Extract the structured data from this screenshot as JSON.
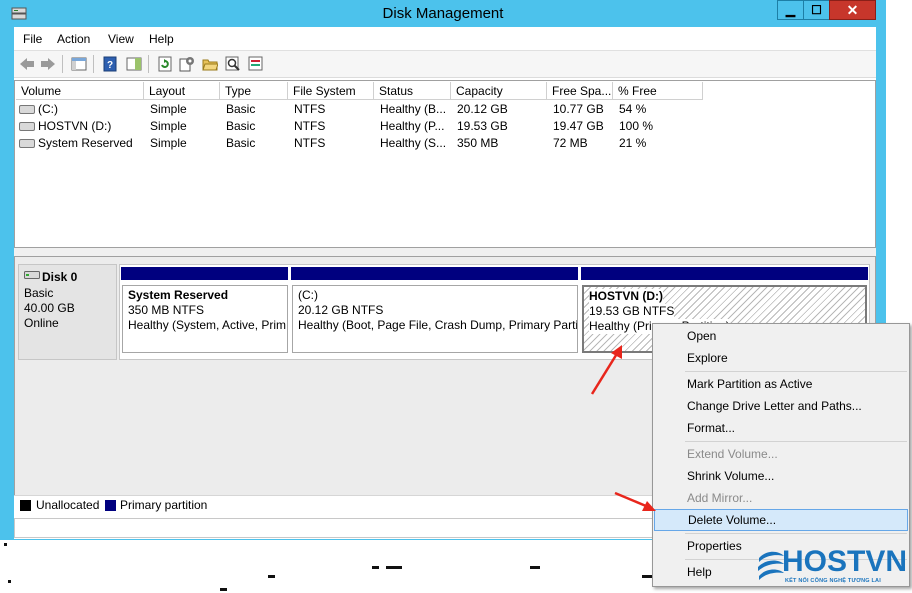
{
  "window": {
    "title": "Disk Management",
    "controls": {
      "minimize": "▁",
      "maximize": "☐",
      "close": "✕"
    },
    "accent": "#4cc2ec"
  },
  "menu": [
    "File",
    "Action",
    "View",
    "Help"
  ],
  "toolbar": {
    "icons": [
      "back-icon",
      "forward-icon",
      "console-tree-icon",
      "help-icon",
      "properties-pane-icon",
      "refresh-icon",
      "settings-icon",
      "open-folder-icon",
      "search-icon",
      "export-icon"
    ]
  },
  "volume_list": {
    "columns": [
      "Volume",
      "Layout",
      "Type",
      "File System",
      "Status",
      "Capacity",
      "Free Spa...",
      "% Free"
    ],
    "rows": [
      [
        "(C:)",
        "Simple",
        "Basic",
        "NTFS",
        "Healthy (B...",
        "20.12 GB",
        "10.77 GB",
        "54 %"
      ],
      [
        "HOSTVN (D:)",
        "Simple",
        "Basic",
        "NTFS",
        "Healthy (P...",
        "19.53 GB",
        "19.47 GB",
        "100 %"
      ],
      [
        "System Reserved",
        "Simple",
        "Basic",
        "NTFS",
        "Healthy (S...",
        "350 MB",
        "72 MB",
        "21 %"
      ]
    ]
  },
  "disk": {
    "name": "Disk 0",
    "type": "Basic",
    "size": "40.00 GB",
    "state": "Online",
    "partitions": [
      {
        "name": "System Reserved",
        "size": "350 MB NTFS",
        "status": "Healthy (System, Active, Prim"
      },
      {
        "name": "(C:)",
        "size": "20.12 GB NTFS",
        "status": "Healthy (Boot, Page File, Crash Dump, Primary Partit"
      },
      {
        "name": "HOSTVN  (D:)",
        "size": "19.53 GB NTFS",
        "status": "Healthy (Primary Partition)"
      }
    ]
  },
  "legend": [
    {
      "label": "Unallocated",
      "color": "#000000"
    },
    {
      "label": "Primary partition",
      "color": "#00007f"
    }
  ],
  "context_menu": {
    "items": [
      {
        "label": "Open",
        "enabled": true
      },
      {
        "label": "Explore",
        "enabled": true
      },
      {
        "label": "Mark Partition as Active",
        "enabled": true
      },
      {
        "label": "Change Drive Letter and Paths...",
        "enabled": true
      },
      {
        "label": "Format...",
        "enabled": true
      },
      {
        "label": "Extend Volume...",
        "enabled": false
      },
      {
        "label": "Shrink Volume...",
        "enabled": true
      },
      {
        "label": "Add Mirror...",
        "enabled": false
      },
      {
        "label": "Delete Volume...",
        "enabled": true,
        "highlighted": true
      },
      {
        "label": "Properties",
        "enabled": true
      },
      {
        "label": "Help",
        "enabled": true
      }
    ]
  },
  "watermark": {
    "brand": "HOSTVN",
    "tagline": "KẾT NỐI CÔNG NGHỆ TƯƠNG LAI"
  },
  "annotation_color": "#e8261c"
}
